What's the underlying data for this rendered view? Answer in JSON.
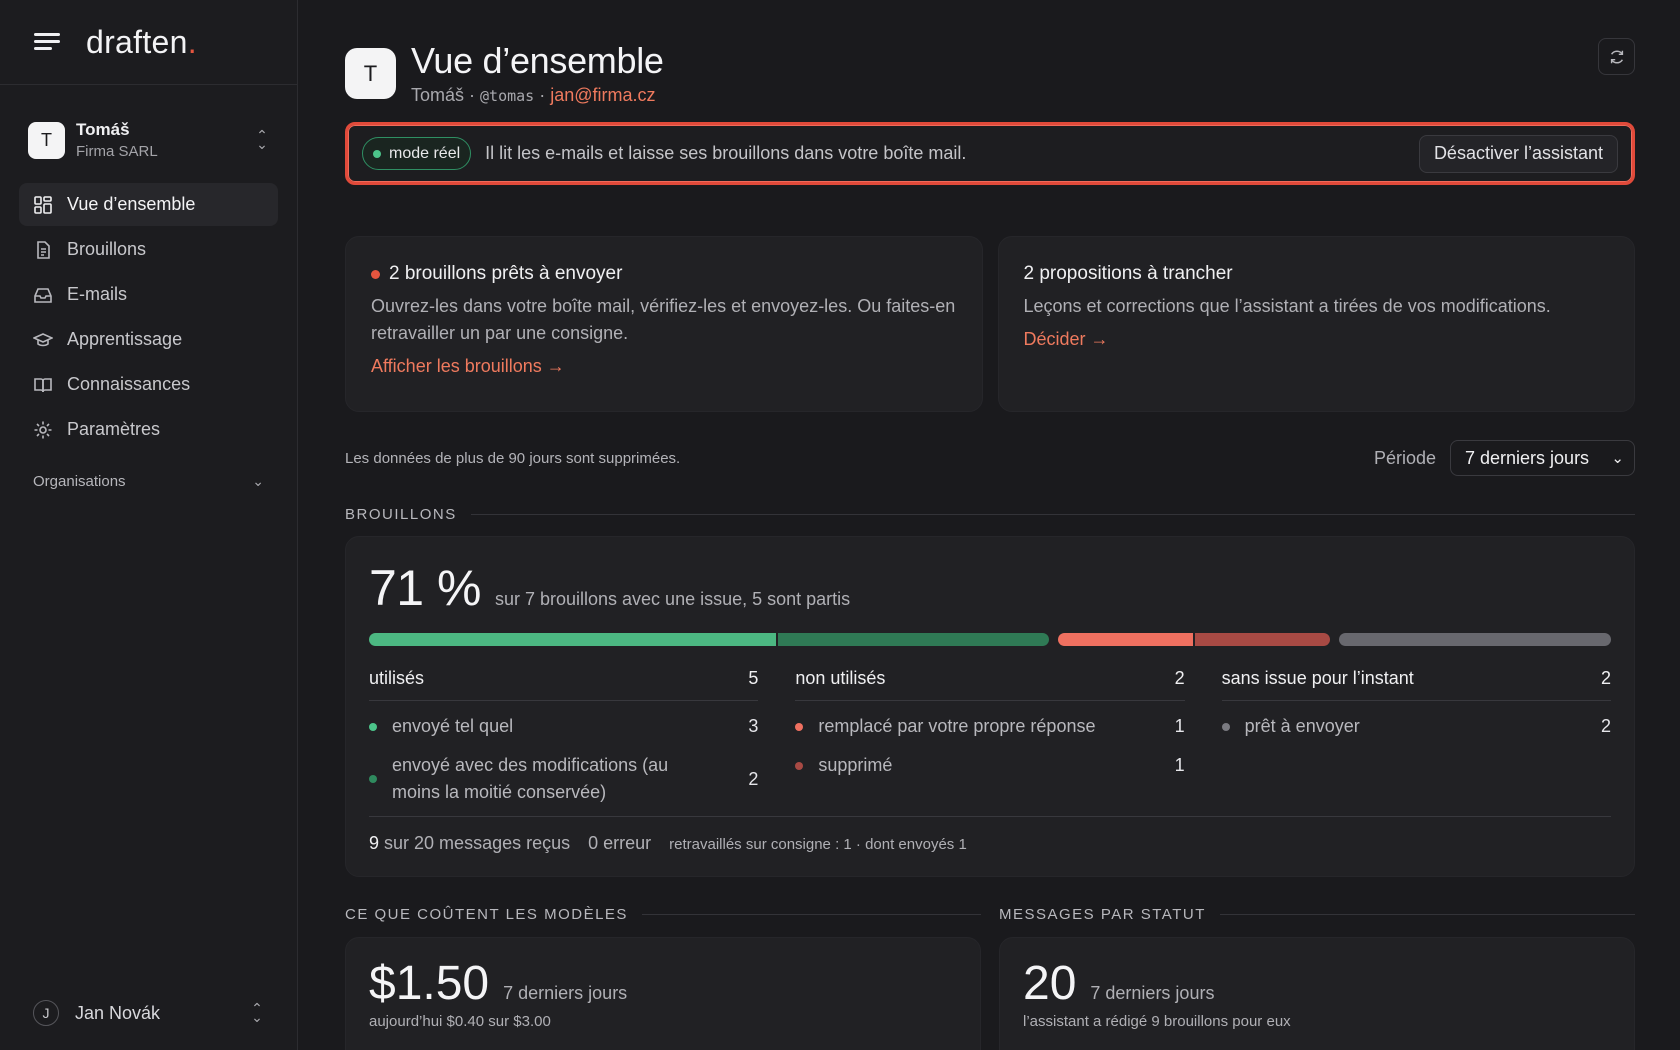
{
  "brand": {
    "name": "draften",
    "dot": "."
  },
  "org": {
    "initial": "T",
    "name": "Tomáš",
    "company": "Firma SARL"
  },
  "nav": {
    "items": [
      {
        "label": "Vue d’ensemble",
        "icon": "dashboard-icon",
        "active": true
      },
      {
        "label": "Brouillons",
        "icon": "document-icon"
      },
      {
        "label": "E-mails",
        "icon": "inbox-icon"
      },
      {
        "label": "Apprentissage",
        "icon": "graduation-cap-icon"
      },
      {
        "label": "Connaissances",
        "icon": "book-icon"
      },
      {
        "label": "Paramètres",
        "icon": "gear-icon"
      }
    ],
    "section": "Organisations"
  },
  "user": {
    "initial": "J",
    "name": "Jan Novák"
  },
  "header": {
    "initial": "T",
    "title": "Vue d’ensemble",
    "name": "Tomáš",
    "sep": " · ",
    "handle": "@tomas",
    "email": "jan@firma.cz"
  },
  "banner": {
    "pill": "mode réel",
    "message": "Il lit les e-mails et laisse ses brouillons dans votre boîte mail.",
    "button": "Désactiver l’assistant"
  },
  "cards": [
    {
      "title": "2 brouillons prêts à envoyer",
      "text": "Ouvrez-les dans votre boîte mail, vérifiez-les et envoyez-les. Ou faites-en retravailler un par une consigne.",
      "link": "Afficher les brouillons →"
    },
    {
      "title": "2 propositions à trancher",
      "text": "Leçons et corrections que l’assistant a tirées de vos modifications.",
      "link": "Décider →"
    }
  ],
  "retention_note": "Les données de plus de 90 jours sont supprimées.",
  "period": {
    "label": "Période",
    "selected": "7 derniers jours"
  },
  "drafts": {
    "section_title": "BROUILLONS",
    "percent": "71 %",
    "percent_sub": "sur 7 brouillons avec une issue, 5 sont partis",
    "bar": [
      {
        "group": "utilisés",
        "segments": [
          {
            "value": 3,
            "color": "#4cb882"
          },
          {
            "value": 2,
            "color": "#2f7a55"
          }
        ]
      },
      {
        "group": "non utilisés",
        "segments": [
          {
            "value": 1,
            "color": "#ef7060"
          },
          {
            "value": 1,
            "color": "#a84a44"
          }
        ]
      },
      {
        "group": "sans issue",
        "segments": [
          {
            "value": 2,
            "color": "#68686e"
          }
        ]
      }
    ],
    "columns": [
      {
        "title": "utilisés",
        "count": "5",
        "rows": [
          {
            "label": "envoyé tel quel",
            "count": "3",
            "color": "#4cc48a"
          },
          {
            "label": "envoyé avec des modifications (au moins la moitié conservée)",
            "count": "2",
            "color": "#2f8a5e"
          }
        ]
      },
      {
        "title": "non utilisés",
        "count": "2",
        "rows": [
          {
            "label": "remplacé par votre propre réponse",
            "count": "1",
            "color": "#ef7060"
          },
          {
            "label": "supprimé",
            "count": "1",
            "color": "#a84a44"
          }
        ]
      },
      {
        "title": "sans issue pour l’instant",
        "count": "2",
        "rows": [
          {
            "label": "prêt à envoyer",
            "count": "2",
            "color": "#7a7a80"
          }
        ]
      }
    ],
    "footer": {
      "received_num": "9",
      "received_text": "sur 20 messages reçus",
      "errors": "0 erreur",
      "reworked": "retravaillés sur consigne : 1 · dont envoyés 1"
    }
  },
  "costs": {
    "section_title": "CE QUE COÛTENT LES MODÈLES",
    "amount": "$1.50",
    "period": "7 derniers jours",
    "sub": "aujourd’hui $0.40 sur $3.00"
  },
  "messages": {
    "section_title": "MESSAGES PAR STATUT",
    "count": "20",
    "period": "7 derniers jours",
    "sub": "l’assistant a rédigé 9 brouillons pour eux"
  }
}
